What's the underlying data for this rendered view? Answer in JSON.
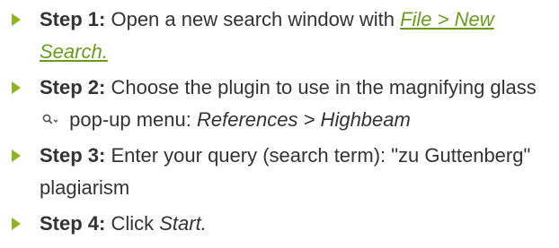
{
  "steps": [
    {
      "label": "Step 1:",
      "text_before": " Open a new search window with ",
      "link_text": "File > New Search."
    },
    {
      "label": "Step 2:",
      "text_before": " Choose the plugin to use in the magnifying glass",
      "icon": "magnifier-dropdown-icon",
      "text_middle": " pop-up menu: ",
      "em_text": "References > Highbeam"
    },
    {
      "label": "Step 3:",
      "text_before": " Enter your query (search term): \"zu Guttenberg\" plagiarism"
    },
    {
      "label": "Step 4:",
      "text_before": " Click ",
      "em_text": "Start."
    }
  ],
  "colors": {
    "bullet": "#8cb51e",
    "link": "#6a9b1d",
    "text": "#333333"
  }
}
